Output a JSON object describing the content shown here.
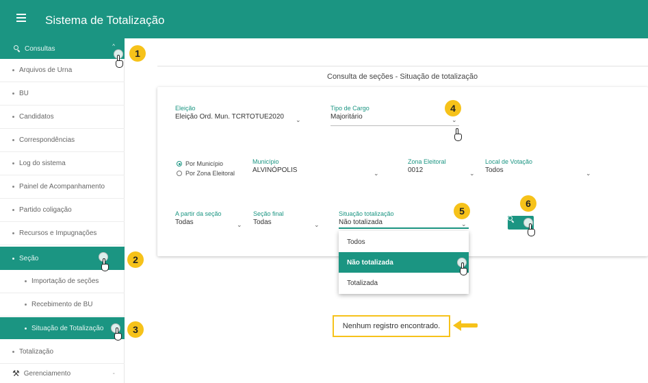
{
  "header": {
    "title": "Sistema de Totalização"
  },
  "sidebar": {
    "consultas": "Consultas",
    "items": [
      "Arquivos de Urna",
      "BU",
      "Candidatos",
      "Correspondências",
      "Log do sistema",
      "Painel de Acompanhamento",
      "Partido coligação",
      "Recursos e Impugnações"
    ],
    "secao": "Seção",
    "sub_items": [
      "Importação de seções",
      "Recebimento de BU",
      "Situação de Totalização"
    ],
    "totalizacao": "Totalização",
    "gerenciamento": "Gerenciamento"
  },
  "page": {
    "title": "Consulta de seções - Situação de totalização"
  },
  "form": {
    "eleicao": {
      "label": "Eleição",
      "value": "Eleição Ord. Mun. TCRTOTUE2020"
    },
    "tipo_cargo": {
      "label": "Tipo de Cargo",
      "value": "Majoritário"
    },
    "radio_municipio": "Por Município",
    "radio_zona": "Por Zona Eleitoral",
    "municipio": {
      "label": "Município",
      "value": "ALVINÓPOLIS"
    },
    "zona": {
      "label": "Zona Eleitoral",
      "value": "0012"
    },
    "local": {
      "label": "Local de Votação",
      "value": "Todos"
    },
    "secao_inicio": {
      "label": "A partir da seção",
      "value": "Todas"
    },
    "secao_final": {
      "label": "Seção final",
      "value": "Todas"
    },
    "situacao": {
      "label": "Situação totalização",
      "value": "Não totalizada"
    }
  },
  "dropdown": {
    "options": [
      "Todos",
      "Não totalizada",
      "Totalizada"
    ],
    "selected_index": 1
  },
  "result": {
    "message": "Nenhum registro encontrado."
  },
  "annotations": [
    "1",
    "2",
    "3",
    "4",
    "5",
    "6"
  ],
  "colors": {
    "primary": "#1b9582",
    "highlight": "#f6c21a"
  }
}
